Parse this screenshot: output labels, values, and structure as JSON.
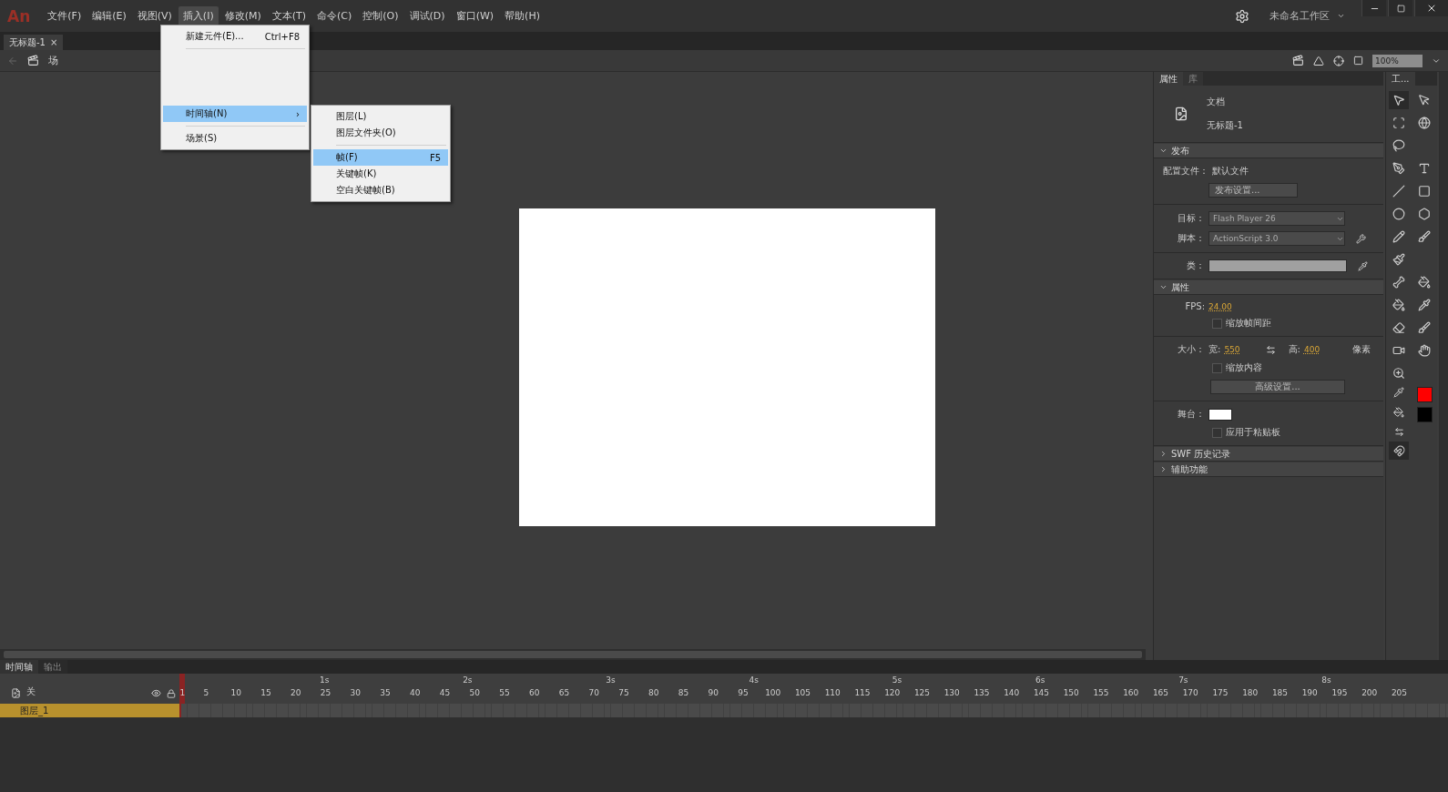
{
  "app_logo": "An",
  "menu": [
    {
      "label": "文件(F)",
      "selected": false
    },
    {
      "label": "编辑(E)",
      "selected": false
    },
    {
      "label": "视图(V)",
      "selected": false
    },
    {
      "label": "插入(I)",
      "selected": true
    },
    {
      "label": "修改(M)",
      "selected": false
    },
    {
      "label": "文本(T)",
      "selected": false
    },
    {
      "label": "命令(C)",
      "selected": false
    },
    {
      "label": "控制(O)",
      "selected": false
    },
    {
      "label": "调试(D)",
      "selected": false
    },
    {
      "label": "窗口(W)",
      "selected": false
    },
    {
      "label": "帮助(H)",
      "selected": false
    }
  ],
  "workspace": "未命名工作区",
  "document_tab": {
    "title": "无标题-1",
    "close": "×"
  },
  "edit_bar": {
    "scene": "场",
    "zoom": "100%"
  },
  "insert_menu": [
    {
      "kind": "item",
      "label": "新建元件(E)...",
      "shortcut": "Ctrl+F8",
      "selected": false
    },
    {
      "kind": "separator"
    },
    {
      "kind": "hidden"
    },
    {
      "kind": "submenu",
      "label": "时间轴(N)",
      "arrow": "›",
      "selected": true
    },
    {
      "kind": "separator"
    },
    {
      "kind": "item",
      "label": "场景(S)",
      "selected": false
    }
  ],
  "timeline_submenu": [
    {
      "kind": "item",
      "label": "图层(L)",
      "selected": false
    },
    {
      "kind": "item",
      "label": "图层文件夹(O)",
      "selected": false
    },
    {
      "kind": "separator"
    },
    {
      "kind": "item",
      "label": "帧(F)",
      "shortcut": "F5",
      "selected": true
    },
    {
      "kind": "item",
      "label": "关键帧(K)",
      "selected": false
    },
    {
      "kind": "item",
      "label": "空白关键帧(B)",
      "selected": false
    }
  ],
  "properties_panel": {
    "tabs": [
      {
        "label": "属性",
        "selected": true
      },
      {
        "label": "库",
        "selected": false
      }
    ],
    "doc_type": "文档",
    "doc_name": "无标题-1",
    "publish": {
      "title": "发布",
      "expanded": true,
      "profile_label": "配置文件：",
      "profile_value": "默认文件",
      "settings_button": "发布设置...",
      "target_label": "目标：",
      "target_value": "Flash Player 26",
      "script_label": "脚本：",
      "script_value": "ActionScript 3.0",
      "class_label": "类："
    },
    "properties": {
      "title": "属性",
      "expanded": true,
      "fps_label": "FPS:",
      "fps_value": "24.00",
      "scale_spans": {
        "label": "缩放帧间距",
        "checked": false
      },
      "size_label": "大小：",
      "width_label": "宽:",
      "width_value": "550",
      "height_label": "高:",
      "height_value": "400",
      "unit": "像素",
      "scale_content": {
        "label": "缩放内容",
        "checked": false
      },
      "advanced_button": "高级设置...",
      "stage_label": "舞台：",
      "apply_pasteboard": {
        "label": "应用于粘贴板",
        "checked": false
      }
    },
    "collapsed_sections": [
      {
        "title": "SWF 历史记录",
        "expanded": false
      },
      {
        "title": "辅助功能",
        "expanded": false
      }
    ]
  },
  "tools_panel": {
    "tab": "工..."
  },
  "timeline": {
    "tabs": [
      {
        "label": "时间轴",
        "selected": true
      },
      {
        "label": "输出",
        "selected": false
      }
    ],
    "header_label": "关",
    "seconds": [
      "1s",
      "2s",
      "3s",
      "4s",
      "5s",
      "6s",
      "7s",
      "8s"
    ],
    "frame_numbers": [
      "1",
      "5",
      "10",
      "15",
      "20",
      "25",
      "30",
      "35",
      "40",
      "45",
      "50",
      "55",
      "60",
      "65",
      "70",
      "75",
      "80",
      "85",
      "90",
      "95",
      "100",
      "105",
      "110",
      "115",
      "120",
      "125",
      "130",
      "135",
      "140",
      "145",
      "150",
      "155",
      "160",
      "165",
      "170",
      "175",
      "180",
      "185",
      "190",
      "195",
      "200",
      "205"
    ],
    "layers": [
      {
        "name": "图层_1",
        "selected": true
      }
    ]
  }
}
